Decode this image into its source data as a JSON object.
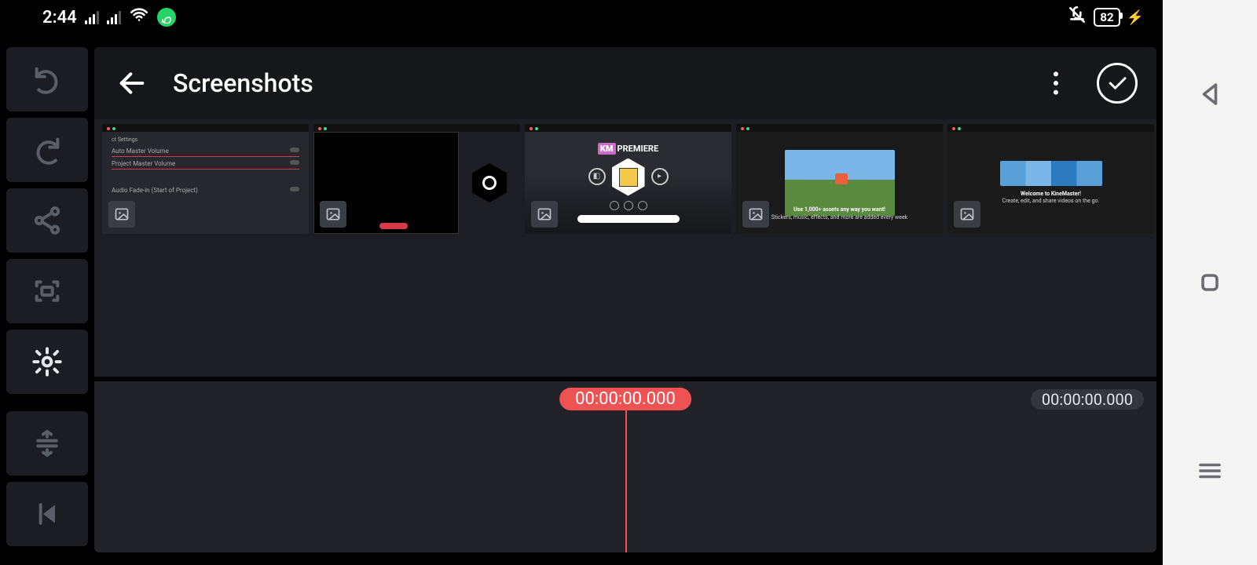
{
  "status": {
    "time": "2:44",
    "battery": "82"
  },
  "header": {
    "title": "Screenshots"
  },
  "thumbs": {
    "t1": {
      "r1": "Auto Master Volume",
      "r2": "Project Master Volume",
      "r3": "Audio Fade-in (Start of Project)",
      "section": "ct Settings"
    },
    "t3": {
      "brand_pre": "KM",
      "brand": "PREMIERE"
    },
    "t4": {
      "line1": "Use 1,000+ assets any way you want!",
      "line2": "Stickers, music, effects, and more are added every week"
    },
    "t5": {
      "line1": "Welcome to KineMaster!",
      "line2": "Create, edit, and share videos on the go."
    }
  },
  "timeline": {
    "pos": "00:00:00.000",
    "dur": "00:00:00.000"
  }
}
